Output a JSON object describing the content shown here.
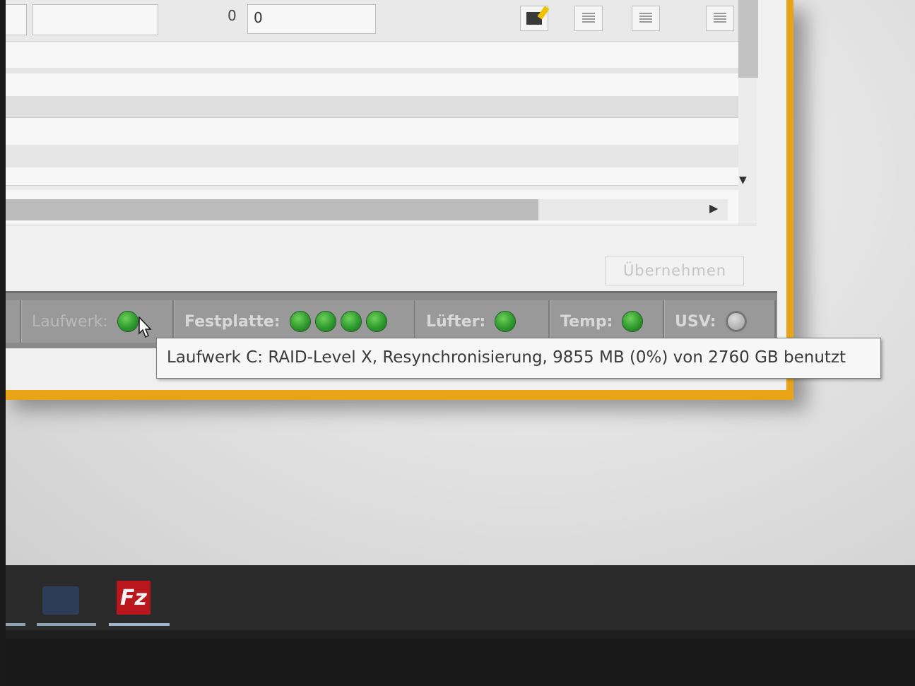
{
  "toolbar_row": {
    "left_value": "0",
    "input_value": "0"
  },
  "apply_button": {
    "label": "Übernehmen"
  },
  "statusbar": {
    "drive_label": "Laufwerk:",
    "disk_label": "Festplatte:",
    "fan_label": "Lüfter:",
    "temp_label": "Temp:",
    "ups_label": "USV:",
    "disk_led_count": 4,
    "led_ok_color": "#2e9a2e",
    "led_off_color": "#a9a9a9"
  },
  "tooltip": {
    "text": "Laufwerk C: RAID-Level X, Resynchronisierung, 9855 MB (0%) von 2760 GB benutzt"
  },
  "taskbar": {
    "filezilla_icon_text": "Fz"
  },
  "colors": {
    "window_accent": "#e8a317",
    "statusbar_bg": "#8a8a8a",
    "tooltip_bg": "#f7f7f7"
  }
}
